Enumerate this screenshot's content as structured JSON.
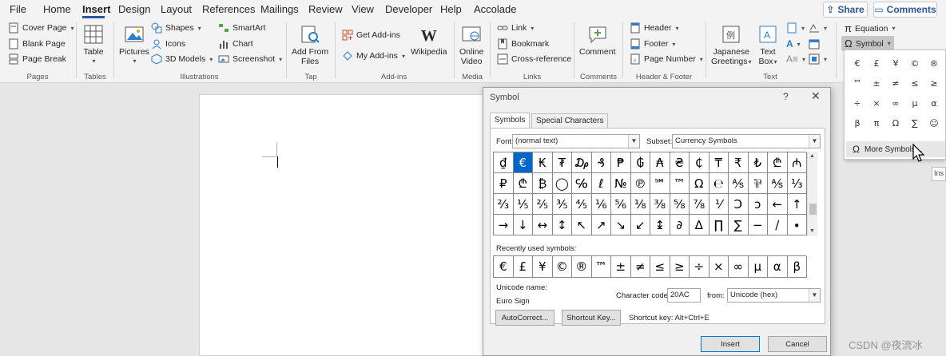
{
  "menu": {
    "tabs": [
      "File",
      "Home",
      "Insert",
      "Design",
      "Layout",
      "References",
      "Mailings",
      "Review",
      "View",
      "Developer",
      "Help",
      "Accolade"
    ],
    "share_label": "Share",
    "comments_label": "Comments"
  },
  "ribbon": {
    "pages": {
      "cover_page": "Cover Page",
      "blank_page": "Blank Page",
      "page_break": "Page Break",
      "label": "Pages"
    },
    "tables": {
      "table": "Table",
      "label": "Tables"
    },
    "illustrations": {
      "pictures": "Pictures",
      "shapes": "Shapes",
      "icons": "Icons",
      "models": "3D Models",
      "smartart": "SmartArt",
      "chart": "Chart",
      "screenshot": "Screenshot",
      "label": "Illustrations"
    },
    "tap": {
      "add_from_files_1": "Add From",
      "add_from_files_2": "Files",
      "label": "Tap"
    },
    "addins": {
      "get_addins": "Get Add-ins",
      "my_addins": "My Add-ins",
      "wikipedia": "Wikipedia",
      "label": "Add-ins"
    },
    "media": {
      "online_video_1": "Online",
      "online_video_2": "Video",
      "label": "Media"
    },
    "links": {
      "link": "Link",
      "bookmark": "Bookmark",
      "cross_reference": "Cross-reference",
      "label": "Links"
    },
    "comments": {
      "comment": "Comment",
      "label": "Comments"
    },
    "header_footer": {
      "header": "Header",
      "footer": "Footer",
      "page_number": "Page Number",
      "label": "Header & Footer"
    },
    "text": {
      "japanese_greetings_1": "Japanese",
      "japanese_greetings_2": "Greetings",
      "text_box_1": "Text",
      "text_box_2": "Box",
      "label": "Text"
    },
    "symbols": {
      "equation": "Equation",
      "symbol": "Symbol"
    }
  },
  "dialog": {
    "title": "Symbol",
    "help": "?",
    "close": "✕",
    "tab_symbols": "Symbols",
    "tab_special": "Special Characters",
    "font_label": "Font:",
    "font_value": "(normal text)",
    "subset_label": "Subset:",
    "subset_value": "Currency Symbols",
    "symbols": [
      "₫",
      "€",
      "₭",
      "₮",
      "₯",
      "₰",
      "₱",
      "₲",
      "₳",
      "₴",
      "₵",
      "₸",
      "₹",
      "₺",
      "₾",
      "₼",
      "₽",
      "₾",
      "₿",
      "◯",
      "℅",
      "ℓ",
      "№",
      "℗",
      "℠",
      "™",
      "Ω",
      "℮",
      "⅍",
      "⅌",
      "⅍",
      "⅓",
      "⅔",
      "⅕",
      "⅖",
      "⅗",
      "⅘",
      "⅙",
      "⅚",
      "⅛",
      "⅜",
      "⅝",
      "⅞",
      "⅟",
      "Ↄ",
      "ↄ",
      "←",
      "↑",
      "→",
      "↓",
      "↔",
      "↕",
      "↖",
      "↗",
      "↘",
      "↙",
      "↨",
      "∂",
      "∆",
      "∏",
      "∑",
      "−",
      "∕",
      "∙"
    ],
    "recent_label": "Recently used symbols:",
    "recent": [
      "€",
      "£",
      "¥",
      "©",
      "®",
      "™",
      "±",
      "≠",
      "≤",
      "≥",
      "÷",
      "×",
      "∞",
      "µ",
      "α",
      "β"
    ],
    "unicode_name_label": "Unicode name:",
    "unicode_name": "Euro Sign",
    "char_code_label": "Character code:",
    "char_code": "20AC",
    "from_label": "from:",
    "from_value": "Unicode (hex)",
    "autocorrect": "AutoCorrect...",
    "shortcut_key_btn": "Shortcut Key...",
    "shortcut_key_text": "Shortcut key: Alt+Ctrl+E",
    "insert": "Insert",
    "cancel": "Cancel"
  },
  "symbol_dropdown": {
    "symbols": [
      "€",
      "£",
      "¥",
      "©",
      "®",
      "™",
      "±",
      "≠",
      "≤",
      "≥",
      "÷",
      "×",
      "∞",
      "µ",
      "α",
      "β",
      "π",
      "Ω",
      "∑",
      "☺"
    ],
    "more_symbols": "More Symbols..."
  },
  "tooltip": "Ins",
  "watermark": "CSDN @夜流冰",
  "colors": {
    "accent": "#2b579a",
    "selected": "#0066cc"
  }
}
